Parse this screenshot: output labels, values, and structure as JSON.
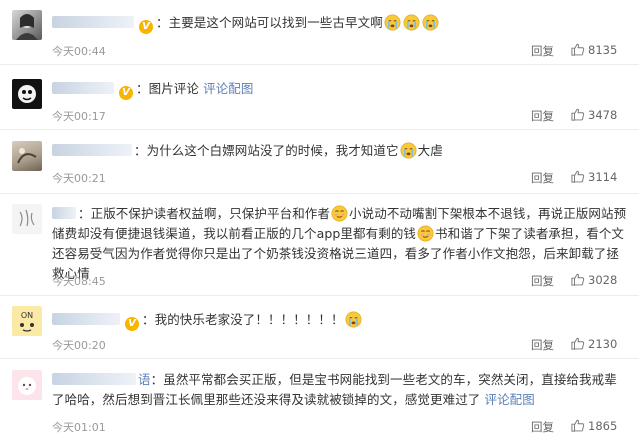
{
  "comments": [
    {
      "text_a": "主要是这个网站可以找到一些古早文啊",
      "time": "今天00:44",
      "reply": "回复",
      "likes": "8135",
      "verified": true
    },
    {
      "text_a": "图片评论",
      "link": "评论配图",
      "time": "今天00:17",
      "reply": "回复",
      "likes": "3478",
      "verified": true
    },
    {
      "text_a": "为什么这个白嫖网站没了的时候，我才知道它",
      "text_b": "大虐",
      "time": "今天00:21",
      "reply": "回复",
      "likes": "3114",
      "verified": false
    },
    {
      "text_a": "正版不保护读者权益啊，只保护平台和作者",
      "text_b": "小说动不动嘴割下架根本不退钱，再说正版网站预储费却没有便捷退钱渠道，我以前看正版的几个app里都有剩的钱",
      "text_c": "书和谐了下架了读者承担，看个文还容易受气因为作者觉得你只是出了个奶茶钱没资格说三道四，看多了作者小作文抱怨，后来卸载了拯救心情",
      "time": "今天08:45",
      "reply": "回复",
      "likes": "3028",
      "verified": false
    },
    {
      "text_a": "我的快乐老家没了！！！！！！！",
      "time": "今天00:20",
      "reply": "回复",
      "likes": "2130",
      "verified": true
    },
    {
      "name_tail": "语",
      "text_a": "虽然平常都会买正版，但是宝书网能找到一些老文的车，突然关闭，直接给我戒辈了哈哈，然后想到晋江长佩里那些还没来得及读就被锁掉的文，感觉更难过了",
      "link": "评论配图",
      "time": "今天01:01",
      "reply": "回复",
      "likes": "1865",
      "verified": false
    }
  ],
  "icons": {
    "crying_emoji": "crying-face-icon",
    "smirk_emoji": "smirk-face-icon",
    "verified_badge": "v-badge-icon",
    "like": "thumbs-up-icon"
  },
  "colors": {
    "link": "#5d7fb8",
    "verified": "#f7b500",
    "time": "#9a9a9a"
  }
}
